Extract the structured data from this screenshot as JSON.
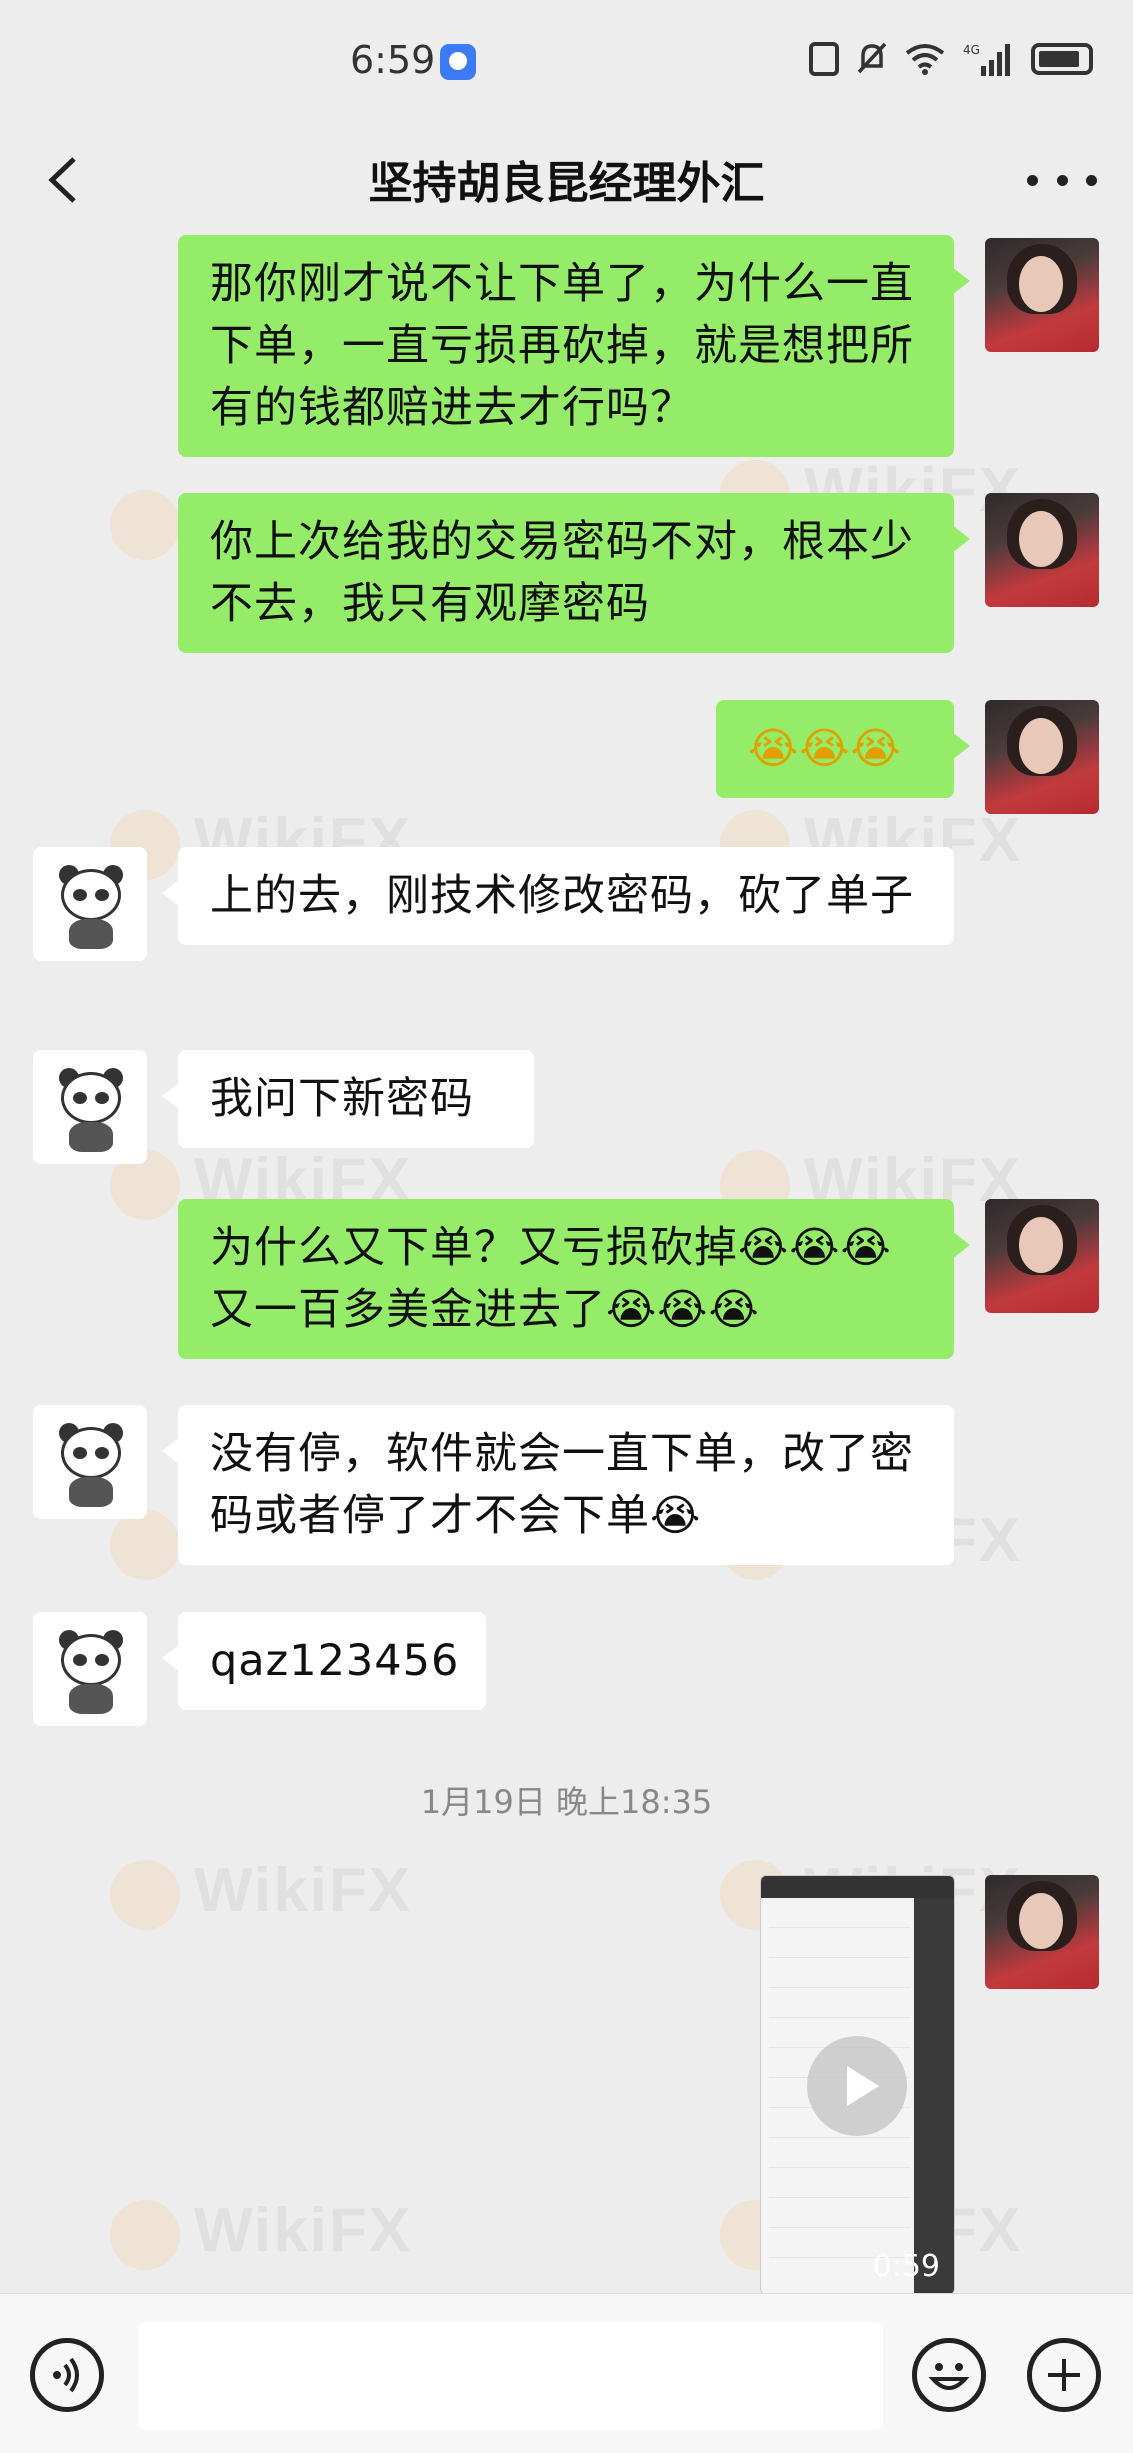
{
  "status_bar": {
    "time": "6:59",
    "network": "4G"
  },
  "header": {
    "title": "坚持胡良昆经理外汇"
  },
  "messages": [
    {
      "sender": "self",
      "text": "那你刚才说不让下单了，为什么一直下单，一直亏损再砍掉，就是想把所有的钱都赔进去才行吗？"
    },
    {
      "sender": "self",
      "text": "你上次给我的交易密码不对，根本少不去，我只有观摩密码"
    },
    {
      "sender": "self",
      "text": "😭😭😭"
    },
    {
      "sender": "other",
      "text": "上的去，刚技术修改密码，砍了单子"
    },
    {
      "sender": "other",
      "text": "我问下新密码"
    },
    {
      "sender": "self",
      "text": "为什么又下单？又亏损砍掉😭😭😭又一百多美金进去了😭😭😭"
    },
    {
      "sender": "other",
      "text": "没有停，软件就会一直下单，改了密码或者停了才不会下单😭"
    },
    {
      "sender": "other",
      "text": "qaz123456"
    }
  ],
  "timestamp": "1月19日 晚上18:35",
  "video": {
    "duration": "0:59"
  },
  "watermark": "WikiFX"
}
